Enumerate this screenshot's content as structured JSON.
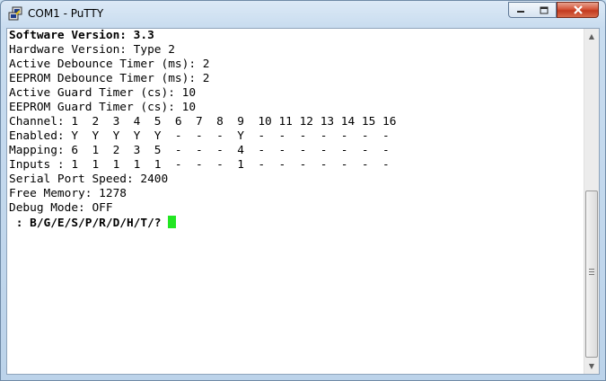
{
  "window": {
    "title": "COM1 - PuTTY",
    "close_color": "#c7402a",
    "cursor_color": "#22e622"
  },
  "icons": {
    "app": "putty-computer-icon",
    "minimize": "minimize-icon",
    "maximize": "maximize-icon",
    "close": "close-icon"
  },
  "terminal": {
    "lines": [
      {
        "text": "Software Version: 3.3",
        "bold": true
      },
      {
        "text": "Hardware Version: Type 2"
      },
      {
        "text": "Active Debounce Timer (ms): 2"
      },
      {
        "text": "EEPROM Debounce Timer (ms): 2"
      },
      {
        "text": "Active Guard Timer (cs): 10"
      },
      {
        "text": "EEPROM Guard Timer (cs): 10"
      },
      {
        "text": "Channel: 1  2  3  4  5  6  7  8  9  10 11 12 13 14 15 16"
      },
      {
        "text": "Enabled: Y  Y  Y  Y  Y  -  -  -  Y  -  -  -  -  -  -  -"
      },
      {
        "text": "Mapping: 6  1  2  3  5  -  -  -  4  -  -  -  -  -  -  -"
      },
      {
        "text": "Inputs : 1  1  1  1  1  -  -  -  1  -  -  -  -  -  -  -"
      },
      {
        "text": "Serial Port Speed: 2400"
      },
      {
        "text": "Free Memory: 1278"
      },
      {
        "text": "Debug Mode: OFF"
      },
      {
        "text": " : B/G/E/S/P/R/D/H/T/? ",
        "bold": true,
        "cursor": true
      }
    ]
  }
}
